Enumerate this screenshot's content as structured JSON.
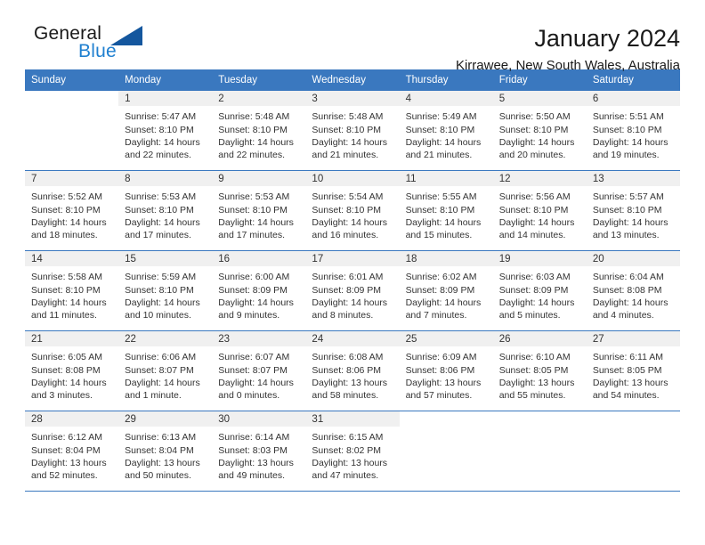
{
  "brand": {
    "word1": "General",
    "word2": "Blue",
    "triangle_color": "#14579e",
    "blue_text_color": "#2080d0"
  },
  "header": {
    "title": "January 2024",
    "subtitle": "Kirrawee, New South Wales, Australia",
    "header_bg": "#3a78bf"
  },
  "weekdays": [
    {
      "label": "Sunday"
    },
    {
      "label": "Monday"
    },
    {
      "label": "Tuesday"
    },
    {
      "label": "Wednesday"
    },
    {
      "label": "Thursday"
    },
    {
      "label": "Friday"
    },
    {
      "label": "Saturday"
    }
  ],
  "weeks": [
    {
      "days": [
        {
          "day": "",
          "sunrise": "",
          "sunset": "",
          "daylight_line1": "",
          "daylight_line2": ""
        },
        {
          "day": "1",
          "sunrise": "Sunrise: 5:47 AM",
          "sunset": "Sunset: 8:10 PM",
          "daylight_line1": "Daylight: 14 hours",
          "daylight_line2": "and 22 minutes."
        },
        {
          "day": "2",
          "sunrise": "Sunrise: 5:48 AM",
          "sunset": "Sunset: 8:10 PM",
          "daylight_line1": "Daylight: 14 hours",
          "daylight_line2": "and 22 minutes."
        },
        {
          "day": "3",
          "sunrise": "Sunrise: 5:48 AM",
          "sunset": "Sunset: 8:10 PM",
          "daylight_line1": "Daylight: 14 hours",
          "daylight_line2": "and 21 minutes."
        },
        {
          "day": "4",
          "sunrise": "Sunrise: 5:49 AM",
          "sunset": "Sunset: 8:10 PM",
          "daylight_line1": "Daylight: 14 hours",
          "daylight_line2": "and 21 minutes."
        },
        {
          "day": "5",
          "sunrise": "Sunrise: 5:50 AM",
          "sunset": "Sunset: 8:10 PM",
          "daylight_line1": "Daylight: 14 hours",
          "daylight_line2": "and 20 minutes."
        },
        {
          "day": "6",
          "sunrise": "Sunrise: 5:51 AM",
          "sunset": "Sunset: 8:10 PM",
          "daylight_line1": "Daylight: 14 hours",
          "daylight_line2": "and 19 minutes."
        }
      ]
    },
    {
      "days": [
        {
          "day": "7",
          "sunrise": "Sunrise: 5:52 AM",
          "sunset": "Sunset: 8:10 PM",
          "daylight_line1": "Daylight: 14 hours",
          "daylight_line2": "and 18 minutes."
        },
        {
          "day": "8",
          "sunrise": "Sunrise: 5:53 AM",
          "sunset": "Sunset: 8:10 PM",
          "daylight_line1": "Daylight: 14 hours",
          "daylight_line2": "and 17 minutes."
        },
        {
          "day": "9",
          "sunrise": "Sunrise: 5:53 AM",
          "sunset": "Sunset: 8:10 PM",
          "daylight_line1": "Daylight: 14 hours",
          "daylight_line2": "and 17 minutes."
        },
        {
          "day": "10",
          "sunrise": "Sunrise: 5:54 AM",
          "sunset": "Sunset: 8:10 PM",
          "daylight_line1": "Daylight: 14 hours",
          "daylight_line2": "and 16 minutes."
        },
        {
          "day": "11",
          "sunrise": "Sunrise: 5:55 AM",
          "sunset": "Sunset: 8:10 PM",
          "daylight_line1": "Daylight: 14 hours",
          "daylight_line2": "and 15 minutes."
        },
        {
          "day": "12",
          "sunrise": "Sunrise: 5:56 AM",
          "sunset": "Sunset: 8:10 PM",
          "daylight_line1": "Daylight: 14 hours",
          "daylight_line2": "and 14 minutes."
        },
        {
          "day": "13",
          "sunrise": "Sunrise: 5:57 AM",
          "sunset": "Sunset: 8:10 PM",
          "daylight_line1": "Daylight: 14 hours",
          "daylight_line2": "and 13 minutes."
        }
      ]
    },
    {
      "days": [
        {
          "day": "14",
          "sunrise": "Sunrise: 5:58 AM",
          "sunset": "Sunset: 8:10 PM",
          "daylight_line1": "Daylight: 14 hours",
          "daylight_line2": "and 11 minutes."
        },
        {
          "day": "15",
          "sunrise": "Sunrise: 5:59 AM",
          "sunset": "Sunset: 8:10 PM",
          "daylight_line1": "Daylight: 14 hours",
          "daylight_line2": "and 10 minutes."
        },
        {
          "day": "16",
          "sunrise": "Sunrise: 6:00 AM",
          "sunset": "Sunset: 8:09 PM",
          "daylight_line1": "Daylight: 14 hours",
          "daylight_line2": "and 9 minutes."
        },
        {
          "day": "17",
          "sunrise": "Sunrise: 6:01 AM",
          "sunset": "Sunset: 8:09 PM",
          "daylight_line1": "Daylight: 14 hours",
          "daylight_line2": "and 8 minutes."
        },
        {
          "day": "18",
          "sunrise": "Sunrise: 6:02 AM",
          "sunset": "Sunset: 8:09 PM",
          "daylight_line1": "Daylight: 14 hours",
          "daylight_line2": "and 7 minutes."
        },
        {
          "day": "19",
          "sunrise": "Sunrise: 6:03 AM",
          "sunset": "Sunset: 8:09 PM",
          "daylight_line1": "Daylight: 14 hours",
          "daylight_line2": "and 5 minutes."
        },
        {
          "day": "20",
          "sunrise": "Sunrise: 6:04 AM",
          "sunset": "Sunset: 8:08 PM",
          "daylight_line1": "Daylight: 14 hours",
          "daylight_line2": "and 4 minutes."
        }
      ]
    },
    {
      "days": [
        {
          "day": "21",
          "sunrise": "Sunrise: 6:05 AM",
          "sunset": "Sunset: 8:08 PM",
          "daylight_line1": "Daylight: 14 hours",
          "daylight_line2": "and 3 minutes."
        },
        {
          "day": "22",
          "sunrise": "Sunrise: 6:06 AM",
          "sunset": "Sunset: 8:07 PM",
          "daylight_line1": "Daylight: 14 hours",
          "daylight_line2": "and 1 minute."
        },
        {
          "day": "23",
          "sunrise": "Sunrise: 6:07 AM",
          "sunset": "Sunset: 8:07 PM",
          "daylight_line1": "Daylight: 14 hours",
          "daylight_line2": "and 0 minutes."
        },
        {
          "day": "24",
          "sunrise": "Sunrise: 6:08 AM",
          "sunset": "Sunset: 8:06 PM",
          "daylight_line1": "Daylight: 13 hours",
          "daylight_line2": "and 58 minutes."
        },
        {
          "day": "25",
          "sunrise": "Sunrise: 6:09 AM",
          "sunset": "Sunset: 8:06 PM",
          "daylight_line1": "Daylight: 13 hours",
          "daylight_line2": "and 57 minutes."
        },
        {
          "day": "26",
          "sunrise": "Sunrise: 6:10 AM",
          "sunset": "Sunset: 8:05 PM",
          "daylight_line1": "Daylight: 13 hours",
          "daylight_line2": "and 55 minutes."
        },
        {
          "day": "27",
          "sunrise": "Sunrise: 6:11 AM",
          "sunset": "Sunset: 8:05 PM",
          "daylight_line1": "Daylight: 13 hours",
          "daylight_line2": "and 54 minutes."
        }
      ]
    },
    {
      "days": [
        {
          "day": "28",
          "sunrise": "Sunrise: 6:12 AM",
          "sunset": "Sunset: 8:04 PM",
          "daylight_line1": "Daylight: 13 hours",
          "daylight_line2": "and 52 minutes."
        },
        {
          "day": "29",
          "sunrise": "Sunrise: 6:13 AM",
          "sunset": "Sunset: 8:04 PM",
          "daylight_line1": "Daylight: 13 hours",
          "daylight_line2": "and 50 minutes."
        },
        {
          "day": "30",
          "sunrise": "Sunrise: 6:14 AM",
          "sunset": "Sunset: 8:03 PM",
          "daylight_line1": "Daylight: 13 hours",
          "daylight_line2": "and 49 minutes."
        },
        {
          "day": "31",
          "sunrise": "Sunrise: 6:15 AM",
          "sunset": "Sunset: 8:02 PM",
          "daylight_line1": "Daylight: 13 hours",
          "daylight_line2": "and 47 minutes."
        },
        {
          "day": "",
          "sunrise": "",
          "sunset": "",
          "daylight_line1": "",
          "daylight_line2": ""
        },
        {
          "day": "",
          "sunrise": "",
          "sunset": "",
          "daylight_line1": "",
          "daylight_line2": ""
        },
        {
          "day": "",
          "sunrise": "",
          "sunset": "",
          "daylight_line1": "",
          "daylight_line2": ""
        }
      ]
    }
  ]
}
